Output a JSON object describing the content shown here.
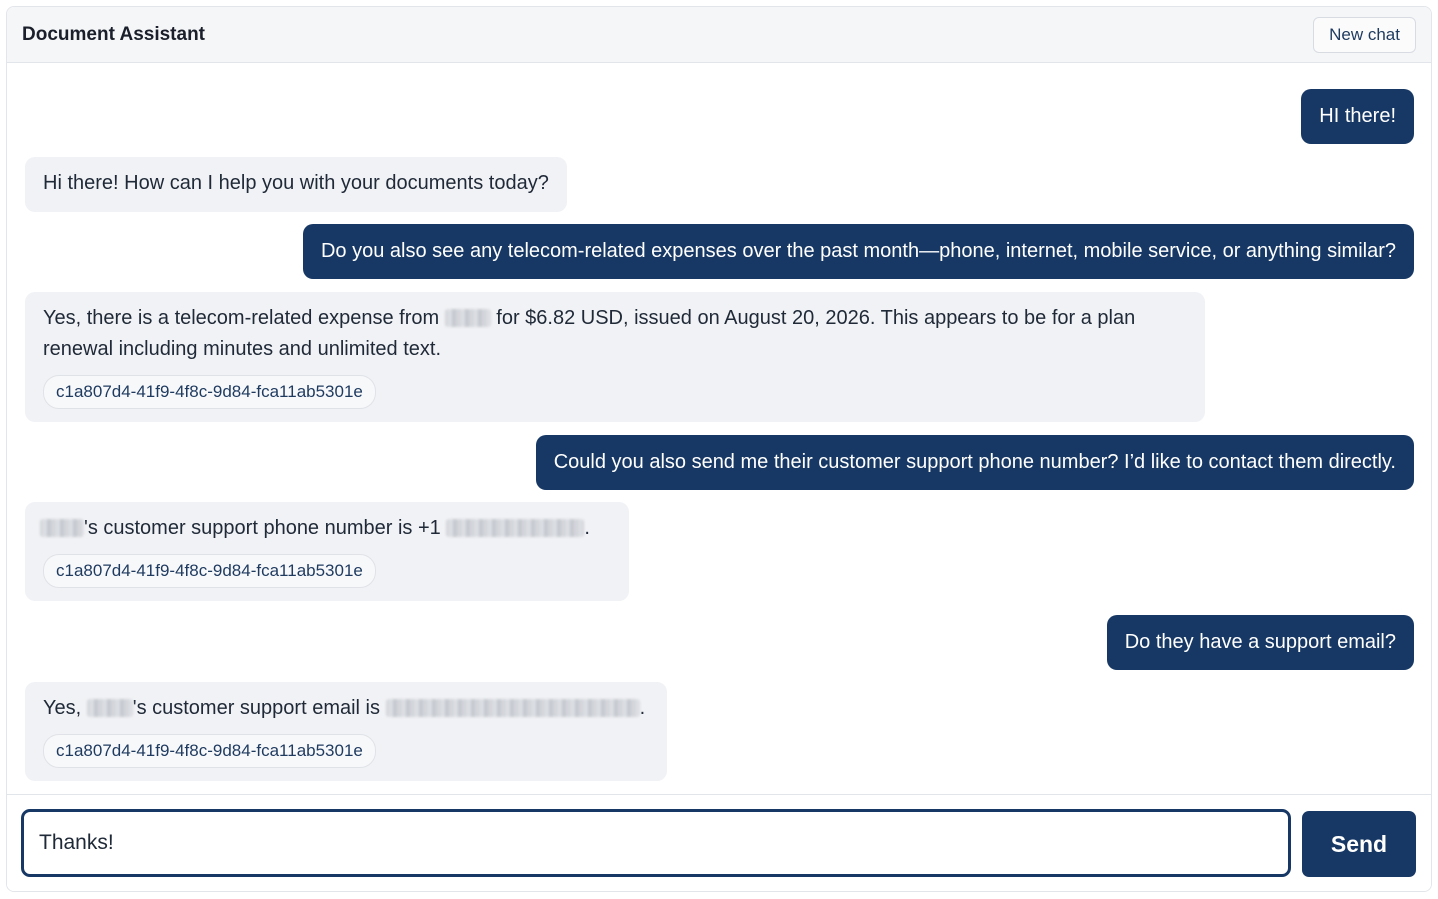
{
  "header": {
    "title": "Document Assistant",
    "new_chat_label": "New chat"
  },
  "messages": [
    {
      "role": "user",
      "text": "HI there!"
    },
    {
      "role": "assistant",
      "text": "Hi there! How can I help you with your documents today?"
    },
    {
      "role": "user",
      "text": "Do you also see any telecom-related expenses over the past month—phone, internet, mobile service, or anything similar?"
    },
    {
      "role": "assistant",
      "text_before_redaction": "Yes, there is a telecom-related expense from",
      "text_after_redaction": "for $6.82 USD, issued on August 20, 2026. This appears to be for a plan renewal including minutes and unlimited text.",
      "source_id": "c1a807d4-41f9-4f8c-9d84-fca11ab5301e"
    },
    {
      "role": "user",
      "text": "Could you also send me their customer support phone number? I’d like to contact them directly."
    },
    {
      "role": "assistant",
      "text_middle": "'s customer support phone number is +1",
      "text_end": ".",
      "source_id": "c1a807d4-41f9-4f8c-9d84-fca11ab5301e"
    },
    {
      "role": "user",
      "text": "Do they have a support email?"
    },
    {
      "role": "assistant",
      "text_start": "Yes,",
      "text_middle": "'s customer support email is",
      "text_end": ".",
      "source_id": "c1a807d4-41f9-4f8c-9d84-fca11ab5301e"
    }
  ],
  "composer": {
    "input_value": "Thanks!",
    "send_label": "Send"
  },
  "colors": {
    "accent": "#173865",
    "assistant_bubble": "#f1f2f5",
    "header_bg": "#f5f6f8"
  }
}
